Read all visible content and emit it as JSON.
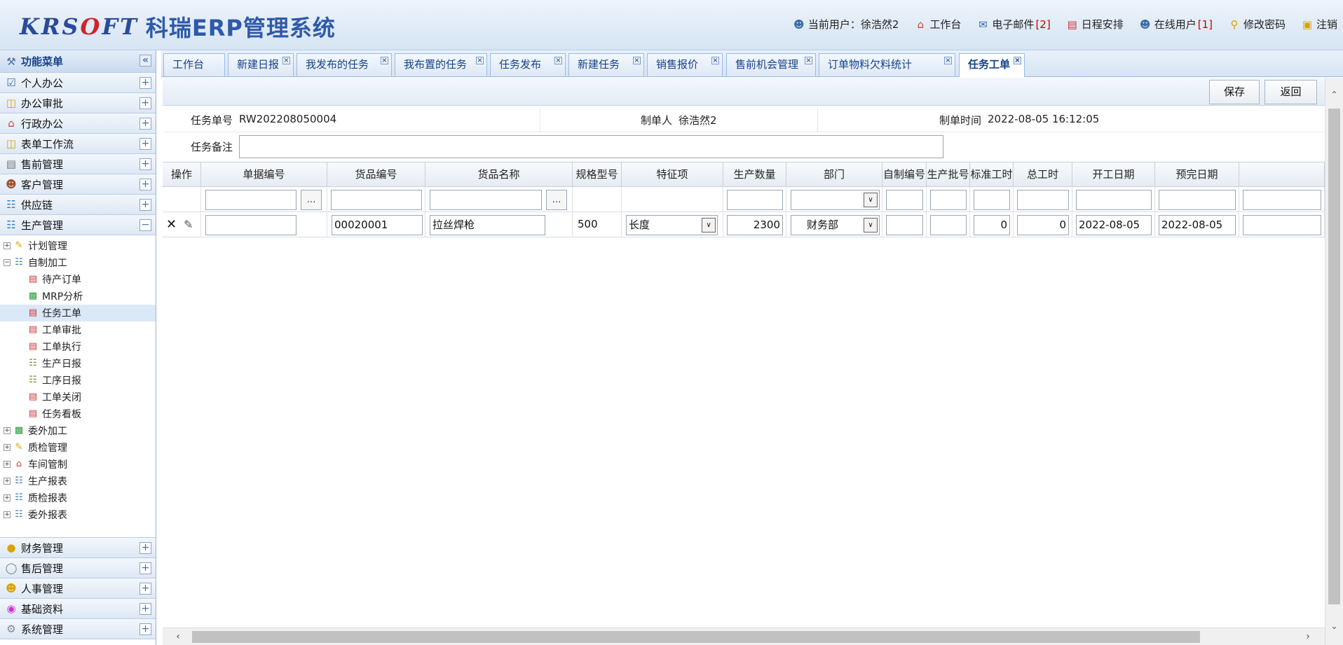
{
  "header": {
    "brand": "KRS",
    "brand_o": "O",
    "brand_ft": "FT",
    "title": "科瑞ERP管理系统",
    "current_user_label": "当前用户：",
    "current_user": "徐浩然2",
    "workbench": "工作台",
    "email": "电子邮件",
    "email_count": "[2]",
    "schedule": "日程安排",
    "online_users": "在线用户",
    "online_count": "[1]",
    "change_password": "修改密码",
    "logout": "注销"
  },
  "sidebar": {
    "title": "功能菜单",
    "collapse_icon": "double-chevron-left",
    "sections_top": [
      {
        "label": "个人办公",
        "icon": "check-mail-icon"
      },
      {
        "label": "办公审批",
        "icon": "folder-icon"
      },
      {
        "label": "行政办公",
        "icon": "house-icon"
      },
      {
        "label": "表单工作流",
        "icon": "folder-icon"
      },
      {
        "label": "售前管理",
        "icon": "document-icon"
      },
      {
        "label": "客户管理",
        "icon": "people-icon"
      },
      {
        "label": "供应链",
        "icon": "network-icon"
      },
      {
        "label": "生产管理",
        "icon": "network-icon",
        "expanded": true
      }
    ],
    "tree": [
      {
        "label": "计划管理",
        "icon": "pencil-icon"
      },
      {
        "label": "自制加工",
        "icon": "network-icon"
      },
      {
        "label": "待产订单",
        "icon": "page-icon"
      },
      {
        "label": "MRP分析",
        "icon": "chart-icon"
      },
      {
        "label": "任务工单",
        "icon": "page-icon",
        "selected": true
      },
      {
        "label": "工单审批",
        "icon": "page-icon"
      },
      {
        "label": "工单执行",
        "icon": "page-icon"
      },
      {
        "label": "生产日报",
        "icon": "book-icon"
      },
      {
        "label": "工序日报",
        "icon": "book-icon"
      },
      {
        "label": "工单关闭",
        "icon": "page-icon"
      },
      {
        "label": "任务看板",
        "icon": "page-icon"
      },
      {
        "label": "委外加工",
        "icon": "chart-icon"
      },
      {
        "label": "质检管理",
        "icon": "pencil-icon"
      },
      {
        "label": "车间管制",
        "icon": "house-icon"
      },
      {
        "label": "生产报表",
        "icon": "network-icon"
      },
      {
        "label": "质检报表",
        "icon": "network-icon"
      },
      {
        "label": "委外报表",
        "icon": "network-icon"
      }
    ],
    "sections_bottom": [
      {
        "label": "财务管理",
        "icon": "coins-icon"
      },
      {
        "label": "售后管理",
        "icon": "headset-icon"
      },
      {
        "label": "人事管理",
        "icon": "person-icon"
      },
      {
        "label": "基础资料",
        "icon": "color-wheel-icon"
      },
      {
        "label": "系统管理",
        "icon": "gear-icon"
      }
    ]
  },
  "tabs": [
    "工作台",
    "新建日报",
    "我发布的任务",
    "我布置的任务",
    "任务发布",
    "新建任务",
    "销售报价",
    "售前机会管理",
    "订单物料欠料统计",
    "任务工单"
  ],
  "toolbar": {
    "save": "保存",
    "back": "返回"
  },
  "form": {
    "task_no_label": "任务单号",
    "task_no": "RW202208050004",
    "creator_label": "制单人",
    "creator": "徐浩然2",
    "created_time_label": "制单时间",
    "created_time": "2022-08-05 16:12:05",
    "remark_label": "任务备注",
    "remark": ""
  },
  "grid": {
    "columns": [
      "操作",
      "单据编号",
      "货品编号",
      "货品名称",
      "规格型号",
      "特征项",
      "生产数量",
      "部门",
      "自制编号",
      "生产批号",
      "标准工时",
      "总工时",
      "开工日期",
      "预完日期"
    ],
    "filter_dots": "…",
    "row": {
      "doc_no": "",
      "item_code": "00020001",
      "item_name": "拉丝焊枪",
      "spec": "500",
      "feature": "长度",
      "quantity": "2300",
      "department": "财务部",
      "self_no": "",
      "batch_no": "",
      "std_hours": "0",
      "total_hours": "0",
      "start_date": "2022-08-05",
      "finish_date": "2022-08-05"
    }
  }
}
